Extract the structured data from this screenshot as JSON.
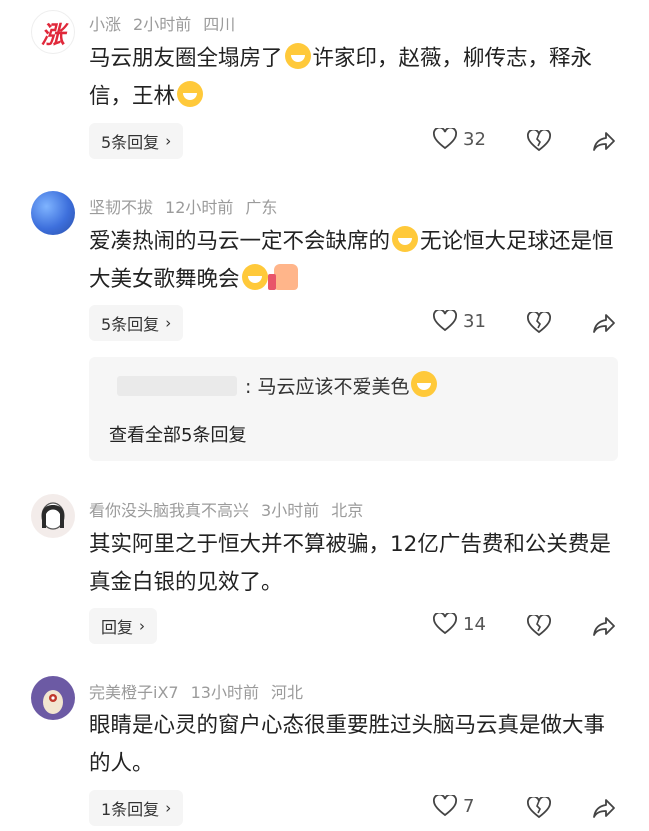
{
  "comments": [
    {
      "user": "小涨",
      "time": "2小时前",
      "location": "四川",
      "avatar_text": "涨",
      "text_parts": [
        "马云朋友圈全塌房了",
        "许家印，赵薇，柳传志，释永信，王林"
      ],
      "reply_label": "5条回复",
      "likes": "32"
    },
    {
      "user": "坚韧不拔",
      "time": "12小时前",
      "location": "广东",
      "text_parts": [
        "爱凑热闹的马云一定不会缺席的",
        "无论恒大足球还是恒大美女歌舞晚会"
      ],
      "reply_label": "5条回复",
      "likes": "31",
      "sub_reply": ": 马云应该不爱美色",
      "view_all": "查看全部5条回复"
    },
    {
      "user": "看你没头脑我真不高兴",
      "time": "3小时前",
      "location": "北京",
      "text": "其实阿里之于恒大并不算被骗，12亿广告费和公关费是真金白银的见效了。",
      "reply_label": "回复",
      "likes": "14"
    },
    {
      "user": "完美橙子iX7",
      "time": "13小时前",
      "location": "河北",
      "text": "眼睛是心灵的窗户心态很重要胜过头脑马云真是做大事的人。",
      "reply_label": "1条回复",
      "likes": "7"
    }
  ],
  "colors": {
    "meta": "#9b9b9b",
    "text": "#222222",
    "button_bg": "#f5f5f5"
  },
  "icons": [
    "heart-icon",
    "broken-heart-icon",
    "share-icon",
    "chevron-right-icon",
    "emoji-laugh-icon",
    "emoji-grin-icon",
    "thumbs-up-icon"
  ]
}
